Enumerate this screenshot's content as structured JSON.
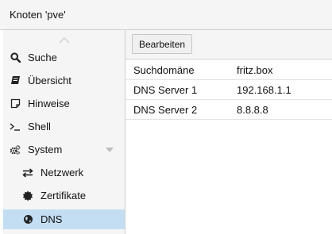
{
  "window": {
    "title": "Knoten 'pve'"
  },
  "sidebar": {
    "items": [
      {
        "label": "Suche",
        "icon": "search-icon"
      },
      {
        "label": "Übersicht",
        "icon": "book-icon"
      },
      {
        "label": "Hinweise",
        "icon": "note-icon"
      },
      {
        "label": "Shell",
        "icon": "terminal-icon"
      },
      {
        "label": "System",
        "icon": "gears-icon",
        "expanded": true
      },
      {
        "label": "Netzwerk",
        "icon": "exchange-icon"
      },
      {
        "label": "Zertifikate",
        "icon": "certificate-icon"
      },
      {
        "label": "DNS",
        "icon": "globe-icon",
        "selected": true
      }
    ]
  },
  "toolbar": {
    "edit_label": "Bearbeiten"
  },
  "dns": {
    "rows": [
      {
        "name": "Suchdomäne",
        "value": "fritz.box"
      },
      {
        "name": "DNS Server 1",
        "value": "192.168.1.1"
      },
      {
        "name": "DNS Server 2",
        "value": "8.8.8.8"
      }
    ]
  },
  "colors": {
    "selected_bg": "#c3ddf3",
    "panel_bg": "#f5f5f5"
  }
}
